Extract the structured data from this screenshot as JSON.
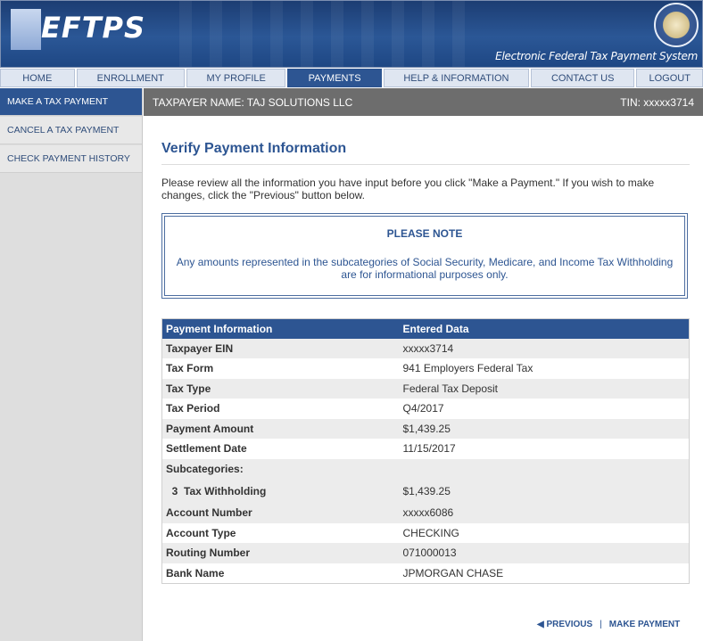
{
  "header": {
    "logo_text": "EFTPS",
    "tagline": "Electronic Federal Tax Payment System"
  },
  "topnav": {
    "tabs": [
      {
        "label": "HOME"
      },
      {
        "label": "ENROLLMENT"
      },
      {
        "label": "MY PROFILE"
      },
      {
        "label": "PAYMENTS"
      },
      {
        "label": "HELP & INFORMATION"
      },
      {
        "label": "CONTACT US"
      },
      {
        "label": "LOGOUT"
      }
    ],
    "active": "PAYMENTS"
  },
  "sidebar": {
    "items": [
      {
        "label": "MAKE A TAX PAYMENT"
      },
      {
        "label": "CANCEL A TAX PAYMENT"
      },
      {
        "label": "CHECK PAYMENT HISTORY"
      }
    ]
  },
  "taxbar": {
    "taxpayer": "TAXPAYER NAME: TAJ SOLUTIONS LLC",
    "tin": "TIN: xxxxx3714"
  },
  "main": {
    "title": "Verify Payment Information",
    "intro": "Please review all the information you have input before you click \"Make a Payment.\" If you wish to make changes, click the \"Previous\" button below.",
    "note_title": "PLEASE NOTE",
    "note_text": "Any amounts represented in the subcategories of Social Security, Medicare, and Income Tax Withholding are for informational purposes only."
  },
  "table": {
    "headers": [
      "Payment Information",
      "Entered Data"
    ],
    "rows": [
      {
        "label": "Taxpayer EIN",
        "value": "xxxxx3714"
      },
      {
        "label": "Tax Form",
        "value": "941 Employers Federal Tax"
      },
      {
        "label": "Tax Type",
        "value": "Federal Tax Deposit"
      },
      {
        "label": "Tax Period",
        "value": "Q4/2017"
      },
      {
        "label": "Payment Amount",
        "value": "$1,439.25"
      },
      {
        "label": "Settlement Date",
        "value": "11/15/2017"
      },
      {
        "label": "Subcategories:",
        "value": ""
      },
      {
        "label": "  3  Tax Withholding",
        "value": "$1,439.25"
      },
      {
        "label": "Account Number",
        "value": "xxxxx6086"
      },
      {
        "label": "Account Type",
        "value": "CHECKING"
      },
      {
        "label": "Routing Number",
        "value": "071000013"
      },
      {
        "label": "Bank Name",
        "value": "JPMORGAN CHASE"
      }
    ]
  },
  "actions": {
    "previous": "PREVIOUS",
    "separator": "|",
    "make_payment": "MAKE PAYMENT"
  },
  "colors": {
    "accent": "#2d5592",
    "taxbar": "#6d6d6d"
  }
}
